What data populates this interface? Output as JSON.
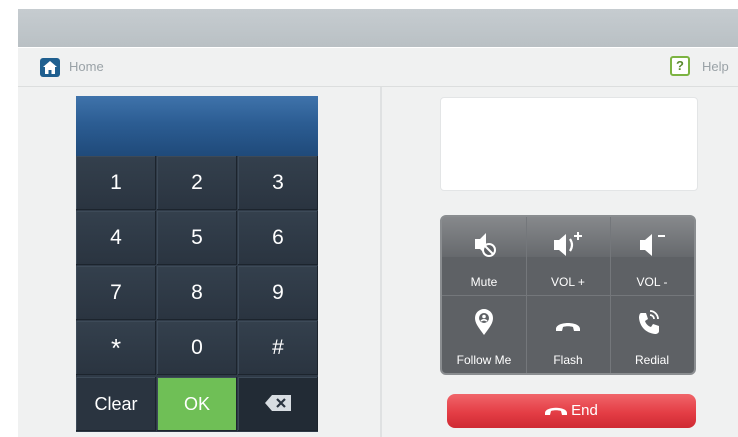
{
  "nav": {
    "home_label": "Home",
    "help_label": "Help",
    "help_glyph": "?"
  },
  "keypad": {
    "keys": [
      "1",
      "2",
      "3",
      "4",
      "5",
      "6",
      "7",
      "8",
      "9",
      "*",
      "0",
      "#"
    ],
    "clear_label": "Clear",
    "ok_label": "OK",
    "backspace_icon": "backspace-icon"
  },
  "controls": {
    "mute_label": "Mute",
    "vol_up_label": "VOL +",
    "vol_down_label": "VOL -",
    "follow_me_label": "Follow Me",
    "flash_label": "Flash",
    "redial_label": "Redial"
  },
  "end_button": {
    "label": "End"
  },
  "colors": {
    "ok_green": "#6fbf56",
    "end_red": "#e43d45",
    "display_blue": "#2c5d93",
    "help_green": "#7cb342"
  }
}
